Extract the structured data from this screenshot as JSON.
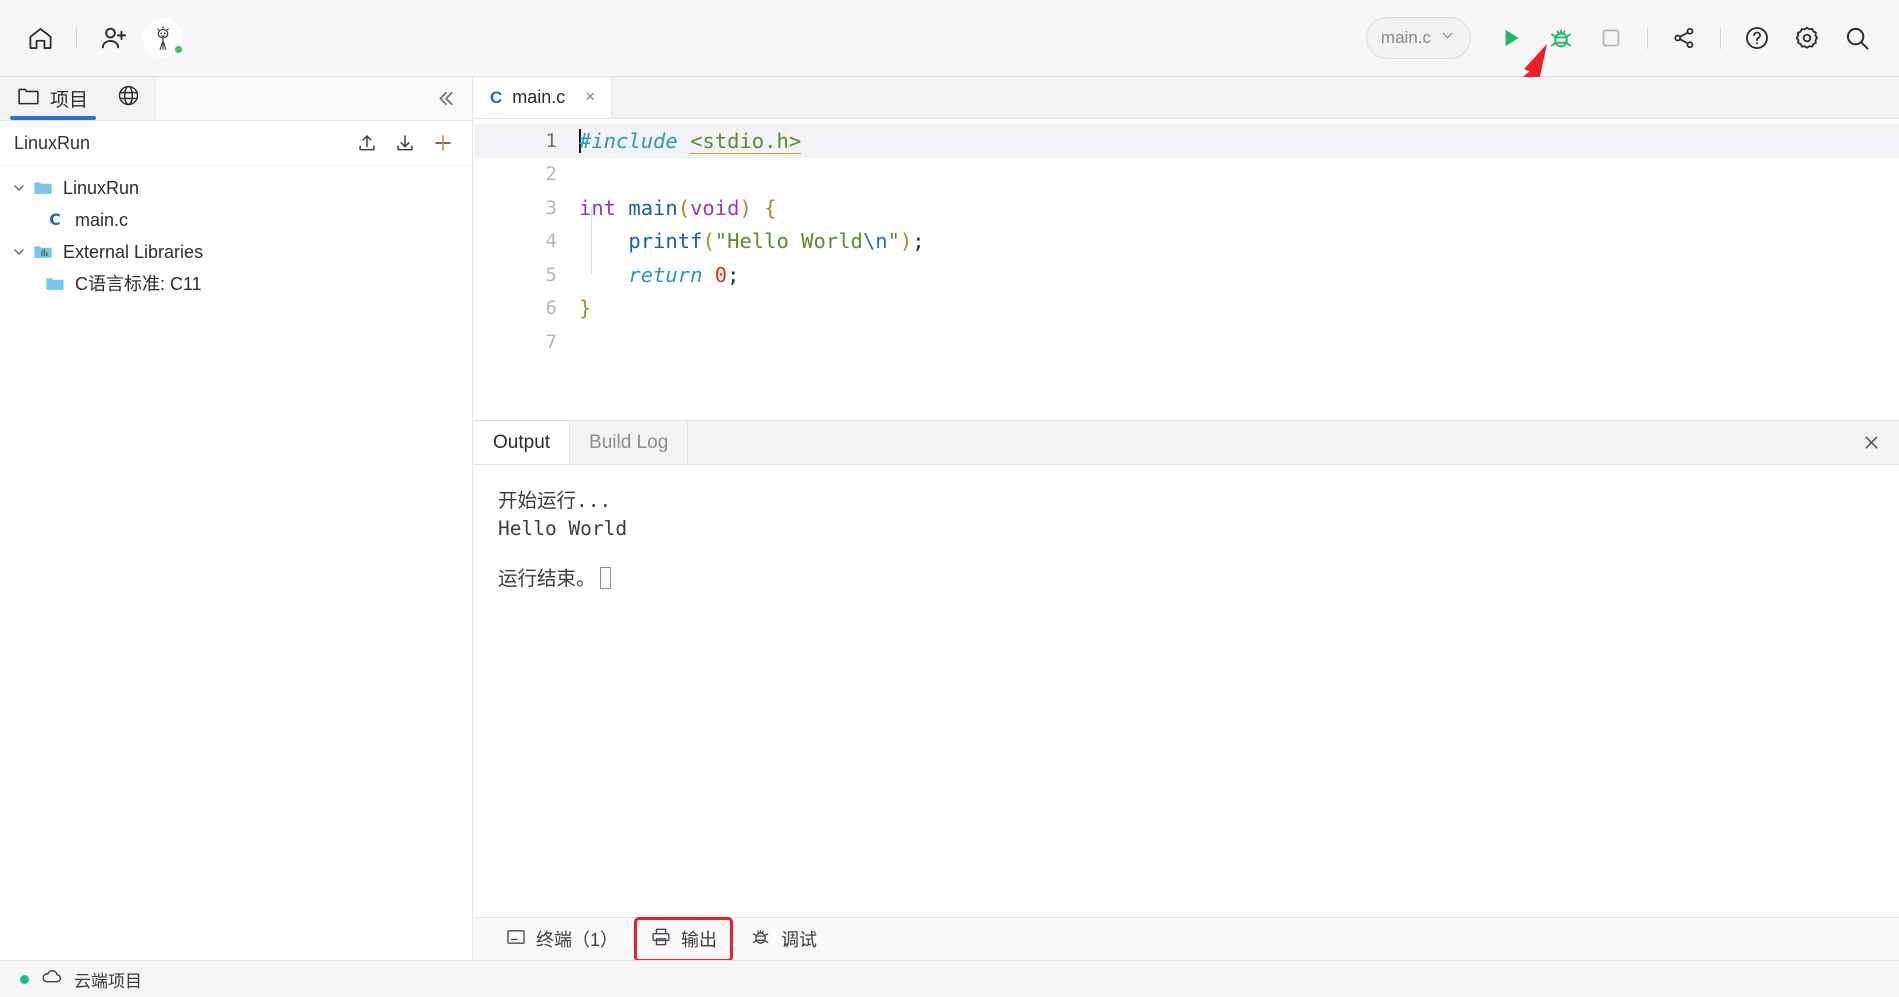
{
  "app": {
    "title": "LinuxRun",
    "accent_blue": "#2f6fdc",
    "accent_green": "#1fb866",
    "highlight_red": "#ec2027",
    "status_green": "#14c08e"
  },
  "topbar": {
    "left_icons": [
      {
        "name": "home-icon",
        "label": "主页"
      },
      {
        "name": "add-user-icon",
        "label": "邀请协作"
      }
    ],
    "avatar": {
      "name": "avatar",
      "label": "用户头像",
      "online": true
    },
    "file_selector": {
      "value": "main.c",
      "chevron": "chevron-down-icon"
    },
    "right_icons": [
      {
        "name": "run-icon",
        "label": "运行",
        "color": "#1fb866"
      },
      {
        "name": "debug-icon",
        "label": "调试",
        "color": "#1fb866"
      },
      {
        "name": "stop-icon",
        "label": "停止",
        "color": "#9aa0a6"
      },
      {
        "name": "share-icon",
        "label": "分享",
        "color": "#3b3b42"
      },
      {
        "name": "help-icon",
        "label": "帮助",
        "color": "#3b3b42"
      },
      {
        "name": "settings-gear-icon",
        "label": "设置",
        "color": "#3b3b42"
      },
      {
        "name": "search-icon",
        "label": "搜索",
        "color": "#3b3b42"
      }
    ]
  },
  "sidebar": {
    "tabs": [
      {
        "name": "tab-project",
        "label": "项目",
        "icon": "folder-icon",
        "active": true
      },
      {
        "name": "tab-web",
        "label": "",
        "icon": "globe-icon",
        "active": false
      }
    ],
    "collapse_icon": "chevron-double-left-icon",
    "project_header": {
      "name": "LinuxRun",
      "actions": [
        {
          "name": "upload-button",
          "icon": "upload-icon",
          "label": "上传"
        },
        {
          "name": "download-button",
          "icon": "download-icon",
          "label": "下载"
        },
        {
          "name": "new-file-button",
          "icon": "plus-icon",
          "label": "新建"
        }
      ]
    },
    "tree": [
      {
        "name": "tree-folder-linuxrun",
        "label": "LinuxRun",
        "icon": "folder-icon",
        "indent": 0,
        "expanded": true,
        "chevron": true
      },
      {
        "name": "tree-file-mainc",
        "label": "main.c",
        "icon": "c-file-icon",
        "indent": 1,
        "expanded": false,
        "chevron": false
      },
      {
        "name": "tree-folder-external-libraries",
        "label": "External Libraries",
        "icon": "library-folder-icon",
        "indent": 0,
        "expanded": true,
        "chevron": true
      },
      {
        "name": "tree-item-c-standard",
        "label": "C语言标准: C11",
        "icon": "folder-icon",
        "indent": 1,
        "expanded": false,
        "chevron": false
      }
    ]
  },
  "editor": {
    "tabs": [
      {
        "name": "editor-tab-mainc",
        "label": "main.c",
        "icon": "c-file-icon",
        "active": true,
        "close": "×"
      }
    ],
    "lines": [
      {
        "num": "1",
        "current": true
      },
      {
        "num": "2",
        "current": false
      },
      {
        "num": "3",
        "current": false
      },
      {
        "num": "4",
        "current": false
      },
      {
        "num": "5",
        "current": false
      },
      {
        "num": "6",
        "current": false
      },
      {
        "num": "7",
        "current": false
      }
    ],
    "code": {
      "l1_pre": "#include",
      "l1_inc": "<stdio.h>",
      "l3_type": "int",
      "l3_fn": "main",
      "l3_open": "(",
      "l3_param": "void",
      "l3_close": ")",
      "l3_brace": "{",
      "l4_fn": "printf",
      "l4_open": "(",
      "l4_str1": "\"Hello World",
      "l4_esc": "\\n",
      "l4_str2": "\"",
      "l4_close": ")",
      "l4_semi": ";",
      "l5_kw": "return",
      "l5_num": "0",
      "l5_semi": ";",
      "l6_brace": "}"
    }
  },
  "output_panel": {
    "tabs": [
      {
        "name": "output-tab-output",
        "label": "Output",
        "active": true
      },
      {
        "name": "output-tab-build-log",
        "label": "Build Log",
        "active": false
      }
    ],
    "close_icon": "close-icon",
    "lines": [
      "开始运行...",
      "Hello World",
      "",
      "运行结束。"
    ]
  },
  "toolstrip": [
    {
      "name": "tool-terminal",
      "label": "终端（1）",
      "icon": "terminal-icon",
      "highlight": false
    },
    {
      "name": "tool-output",
      "label": "输出",
      "icon": "printer-icon",
      "highlight": true
    },
    {
      "name": "tool-debug",
      "label": "调试",
      "icon": "debug-icon",
      "highlight": false
    }
  ],
  "statusbar": {
    "dot_color": "#14c08e",
    "icon": "cloud-icon",
    "label": "云端项目"
  }
}
